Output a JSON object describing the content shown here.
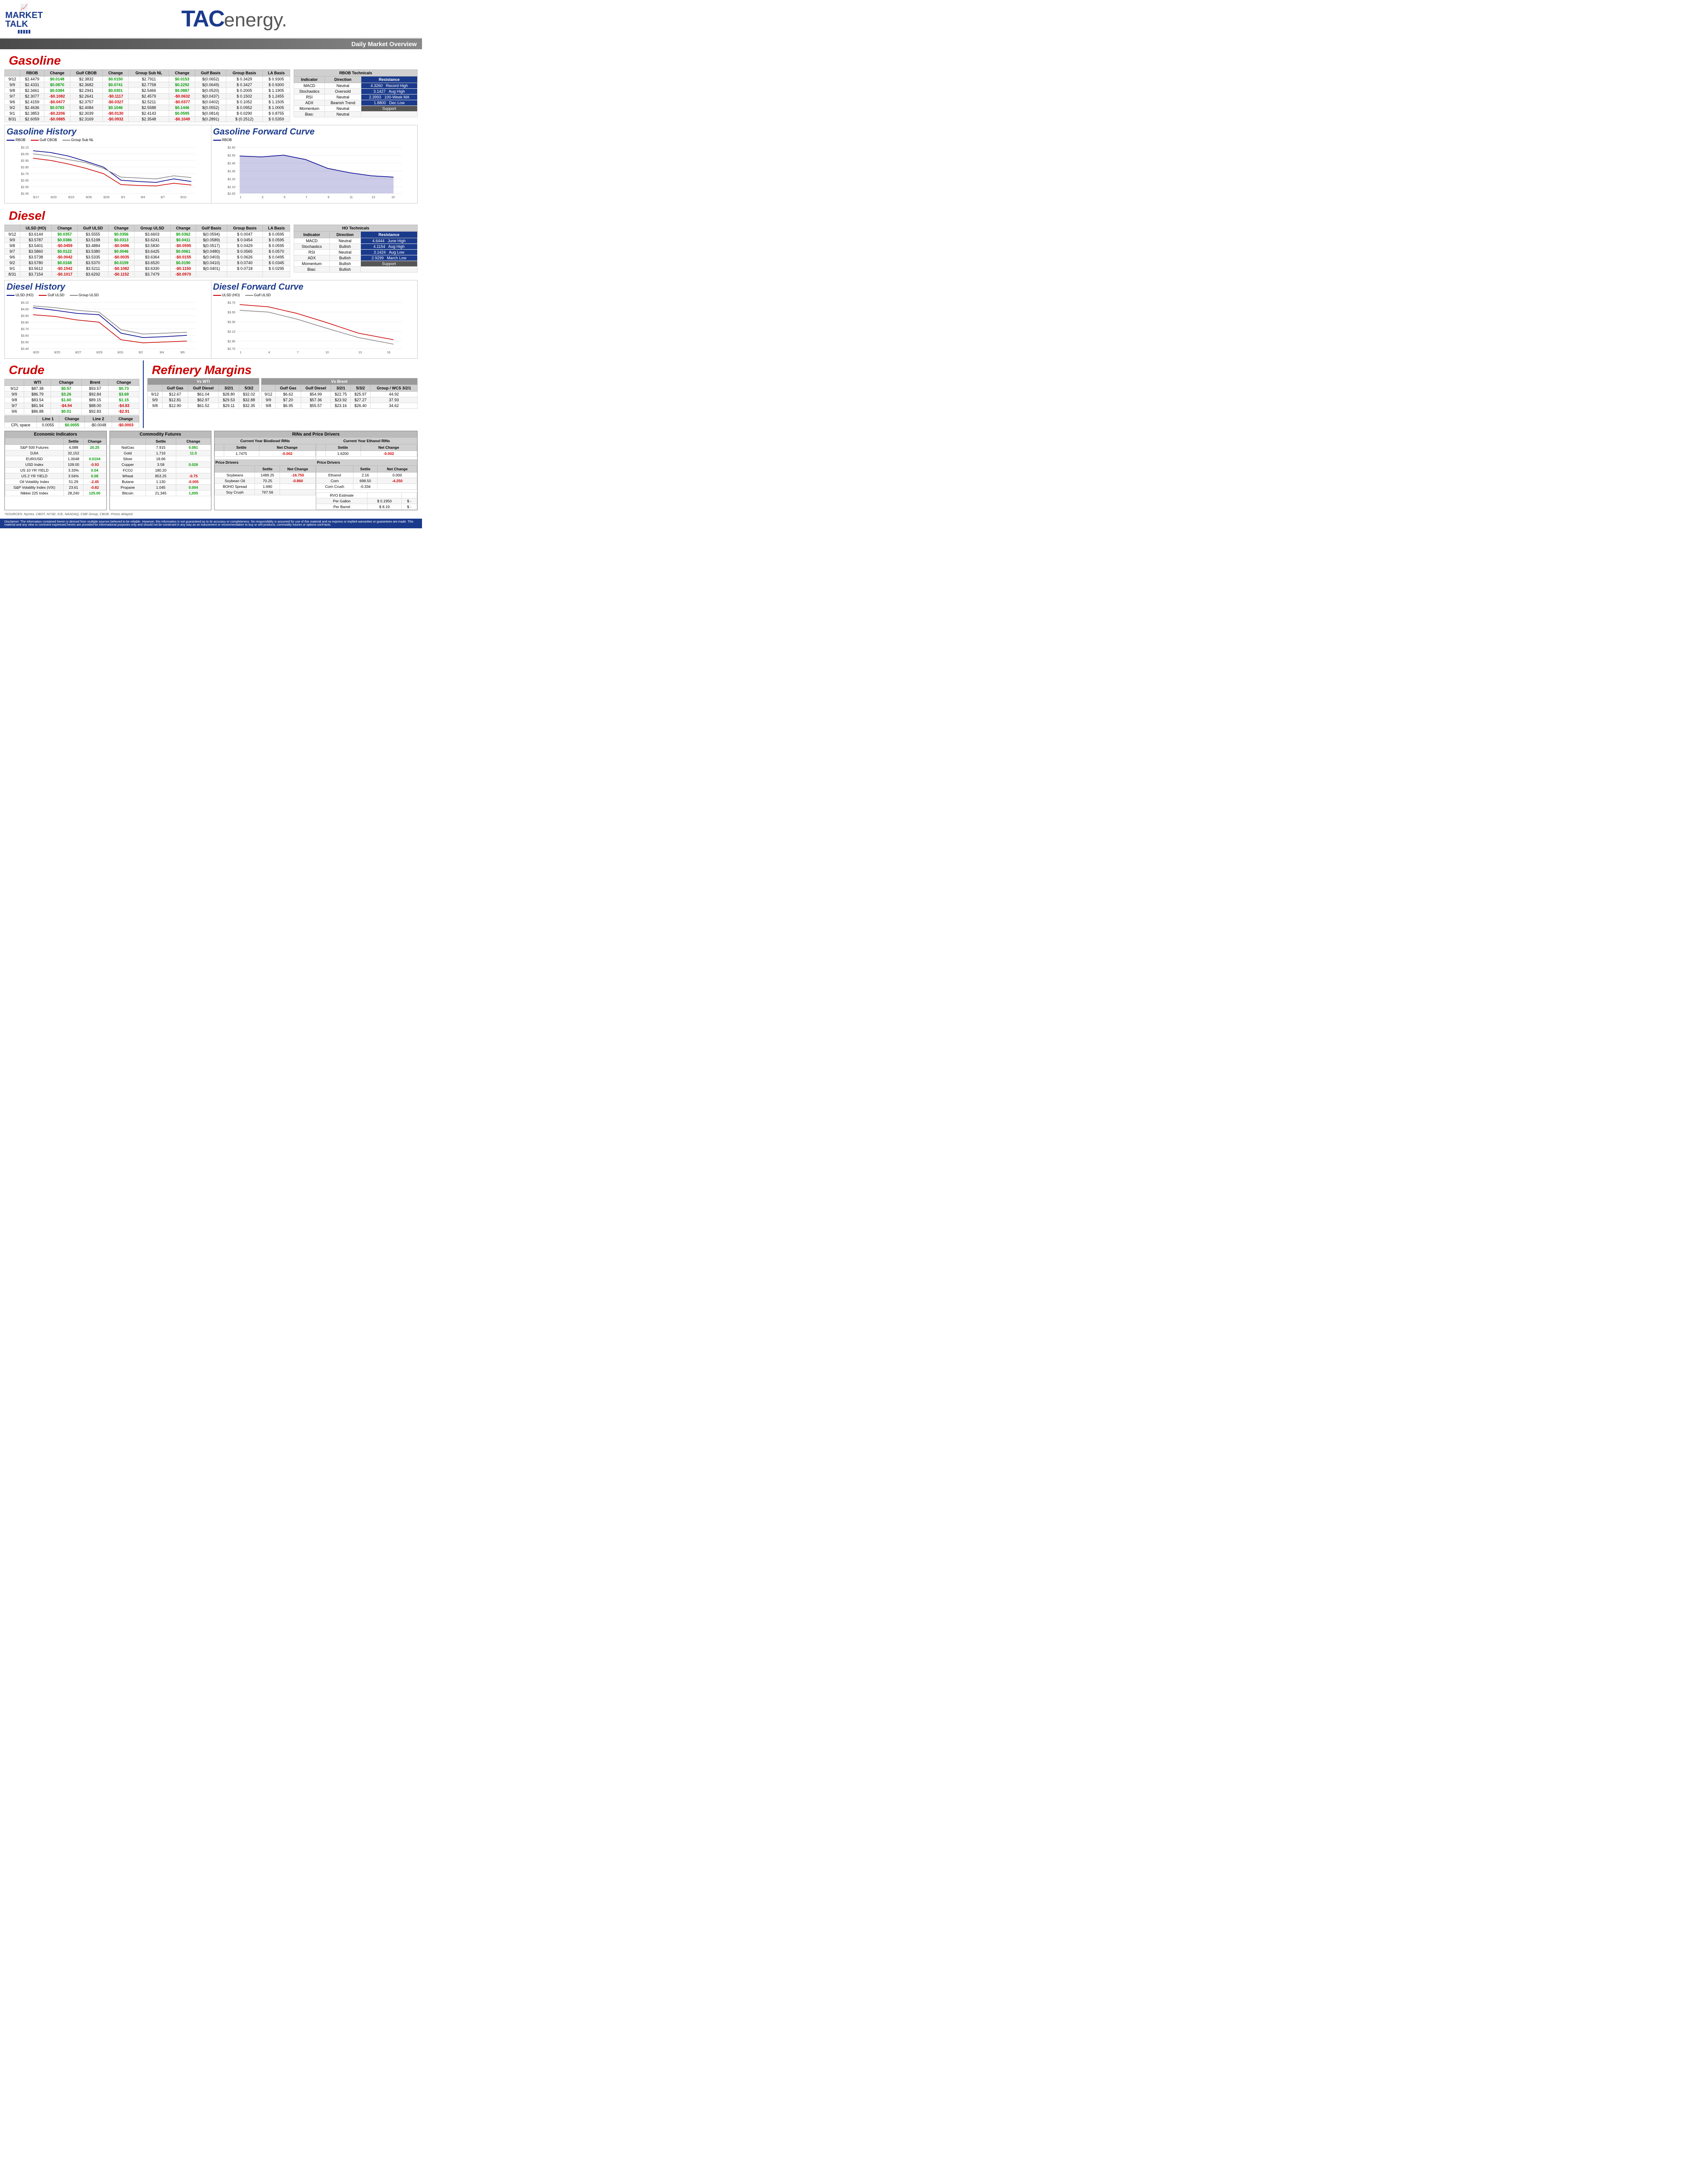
{
  "header": {
    "logo_line1": "MARKET",
    "logo_line2": "TALK",
    "tac_text": "TAC",
    "energy_text": "energy.",
    "daily_overview": "Daily Market Overview"
  },
  "gasoline": {
    "section_title": "Gasoline",
    "columns": [
      "",
      "RBOB",
      "Change",
      "Gulf CBOB",
      "Change",
      "Group Sub NL",
      "Change",
      "Gulf Basis",
      "Group Basis",
      "LA Basis"
    ],
    "rows": [
      {
        "date": "9/12",
        "rbob": "$2.4479",
        "rbob_chg": "$0.0148",
        "gulf_cbob": "$2.3832",
        "gulf_cbob_chg": "$0.0150",
        "group_sub_nl": "$2.7911",
        "group_sub_nl_chg": "$0.0153",
        "gulf_basis": "$(0.0652)",
        "group_basis": "$  0.3429",
        "la_basis": "$  0.9305"
      },
      {
        "date": "9/9",
        "rbob": "$2.4331",
        "rbob_chg": "$0.0870",
        "gulf_cbob": "$2.3682",
        "gulf_cbob_chg": "$0.0741",
        "group_sub_nl": "$2.7758",
        "group_sub_nl_chg": "$0.2292",
        "gulf_basis": "$(0.0649)",
        "group_basis": "$  0.3427",
        "la_basis": "$  0.9300"
      },
      {
        "date": "9/8",
        "rbob": "$2.3461",
        "rbob_chg": "$0.0384",
        "gulf_cbob": "$2.2941",
        "gulf_cbob_chg": "$0.0301",
        "group_sub_nl": "$2.5466",
        "group_sub_nl_chg": "$0.0887",
        "gulf_basis": "$(0.0520)",
        "group_basis": "$  0.2005",
        "la_basis": "$  1.1905"
      },
      {
        "date": "9/7",
        "rbob": "$2.3077",
        "rbob_chg": "-$0.1082",
        "gulf_cbob": "$2.2641",
        "gulf_cbob_chg": "-$0.1117",
        "group_sub_nl": "$2.4579",
        "group_sub_nl_chg": "-$0.0632",
        "gulf_basis": "$(0.0437)",
        "group_basis": "$  0.1502",
        "la_basis": "$  1.2455"
      },
      {
        "date": "9/6",
        "rbob": "$2.4159",
        "rbob_chg": "-$0.0477",
        "gulf_cbob": "$2.3757",
        "gulf_cbob_chg": "-$0.0327",
        "group_sub_nl": "$2.5211",
        "group_sub_nl_chg": "-$0.0377",
        "gulf_basis": "$(0.0402)",
        "group_basis": "$  0.1052",
        "la_basis": "$  1.1505"
      },
      {
        "date": "9/2",
        "rbob": "$2.4636",
        "rbob_chg": "$0.0783",
        "gulf_cbob": "$2.4084",
        "gulf_cbob_chg": "$0.1046",
        "group_sub_nl": "$2.5588",
        "group_sub_nl_chg": "$0.1446",
        "gulf_basis": "$(0.0552)",
        "group_basis": "$  0.0952",
        "la_basis": "$  1.0005"
      },
      {
        "date": "9/1",
        "rbob": "$2.3853",
        "rbob_chg": "-$0.2206",
        "gulf_cbob": "$2.3039",
        "gulf_cbob_chg": "-$0.0130",
        "group_sub_nl": "$2.4143",
        "group_sub_nl_chg": "$0.0595",
        "gulf_basis": "$(0.0814)",
        "group_basis": "$  0.0290",
        "la_basis": "$  0.8755"
      },
      {
        "date": "8/31",
        "rbob": "$2.6059",
        "rbob_chg": "-$0.0885",
        "gulf_cbob": "$2.3169",
        "gulf_cbob_chg": "-$0.0932",
        "group_sub_nl": "$2.3548",
        "group_sub_nl_chg": "-$0.1049",
        "gulf_basis": "$(0.2891)",
        "group_basis": "$  (0.2512)",
        "la_basis": "$  0.5359"
      }
    ],
    "technicals": {
      "title": "RBOB Technicals",
      "headers": [
        "Indicator",
        "Direction",
        "Resistance"
      ],
      "rows": [
        {
          "indicator": "MACD",
          "direction": "Neutral",
          "value": "4.3260",
          "label": "Record High"
        },
        {
          "indicator": "Stochastics",
          "direction": "Oversold",
          "value": "3.1427",
          "label": "Aug High"
        },
        {
          "indicator": "RSI",
          "direction": "Neutral",
          "value": "2.3993",
          "label": "100-Week MA"
        },
        {
          "indicator": "ADX",
          "direction": "Bearish Trend",
          "value": "1.8800",
          "label": "Dec Low"
        },
        {
          "indicator": "Momentum",
          "direction": "Neutral",
          "support_label": "Support"
        },
        {
          "indicator": "Bias:",
          "direction": "Neutral"
        }
      ]
    }
  },
  "gasoline_history": {
    "title": "Gasoline History",
    "legend": [
      "RBOB",
      "Gulf CBOB",
      "Group Sub NL"
    ],
    "y_axis": [
      "$3.15",
      "$3.05",
      "$2.95",
      "$2.85",
      "$2.75",
      "$2.65",
      "$2.55",
      "$2.45",
      "$2.35",
      "$2.25"
    ],
    "x_axis": [
      "8/17",
      "8/20",
      "8/23",
      "8/26",
      "8/29",
      "9/1",
      "9/4",
      "9/7",
      "9/10"
    ]
  },
  "gasoline_forward": {
    "title": "Gasoline Forward Curve",
    "legend": [
      "RBOB"
    ],
    "y_axis": [
      "$2.60",
      "$2.50",
      "$2.40",
      "$2.30",
      "$2.20",
      "$2.10",
      "$2.00"
    ],
    "x_axis": [
      "1",
      "3",
      "5",
      "7",
      "9",
      "11",
      "13",
      "15"
    ]
  },
  "diesel": {
    "section_title": "Diesel",
    "columns": [
      "",
      "ULSD (HO)",
      "Change",
      "Gulf ULSD",
      "Change",
      "Group ULSD",
      "Change",
      "Gulf Basis",
      "Group Basis",
      "LA Basis"
    ],
    "rows": [
      {
        "date": "9/12",
        "ulsd": "$3.6144",
        "ulsd_chg": "$0.0357",
        "gulf_ulsd": "$3.5555",
        "gulf_ulsd_chg": "$0.0356",
        "group_ulsd": "$3.6603",
        "group_ulsd_chg": "$0.0362",
        "gulf_basis": "$(0.0594)",
        "group_basis": "$  0.0047",
        "la_basis": "$  0.0595"
      },
      {
        "date": "9/9",
        "ulsd": "$3.5787",
        "ulsd_chg": "$0.0386",
        "gulf_ulsd": "$3.5198",
        "gulf_ulsd_chg": "$0.0313",
        "group_ulsd": "$3.6241",
        "group_ulsd_chg": "$0.0411",
        "gulf_basis": "$(0.0589)",
        "group_basis": "$  0.0454",
        "la_basis": "$  0.0595"
      },
      {
        "date": "9/8",
        "ulsd": "$3.5401",
        "ulsd_chg": "-$0.0459",
        "gulf_ulsd": "$3.4884",
        "gulf_ulsd_chg": "-$0.0496",
        "group_ulsd": "$3.5830",
        "group_ulsd_chg": "-$0.0595",
        "gulf_basis": "$(0.0517)",
        "group_basis": "$  0.0429",
        "la_basis": "$  0.0595"
      },
      {
        "date": "9/7",
        "ulsd": "$3.5860",
        "ulsd_chg": "$0.0122",
        "gulf_ulsd": "$3.5380",
        "gulf_ulsd_chg": "$0.0046",
        "group_ulsd": "$3.6425",
        "group_ulsd_chg": "$0.0061",
        "gulf_basis": "$(0.0480)",
        "group_basis": "$  0.0565",
        "la_basis": "$  0.0570"
      },
      {
        "date": "9/6",
        "ulsd": "$3.5738",
        "ulsd_chg": "-$0.0042",
        "gulf_ulsd": "$3.5335",
        "gulf_ulsd_chg": "-$0.0035",
        "group_ulsd": "$3.6364",
        "group_ulsd_chg": "-$0.0155",
        "gulf_basis": "$(0.0403)",
        "group_basis": "$  0.0626",
        "la_basis": "$  0.0495"
      },
      {
        "date": "9/2",
        "ulsd": "$3.5780",
        "ulsd_chg": "$0.0168",
        "gulf_ulsd": "$3.5370",
        "gulf_ulsd_chg": "$0.0159",
        "group_ulsd": "$3.6520",
        "group_ulsd_chg": "$0.0190",
        "gulf_basis": "$(0.0410)",
        "group_basis": "$  0.0740",
        "la_basis": "$  0.0345"
      },
      {
        "date": "9/1",
        "ulsd": "$3.5612",
        "ulsd_chg": "-$0.1542",
        "gulf_ulsd": "$3.5211",
        "gulf_ulsd_chg": "-$0.1082",
        "group_ulsd": "$3.6330",
        "group_ulsd_chg": "-$0.1150",
        "gulf_basis": "$(0.0401)",
        "group_basis": "$  0.0718",
        "la_basis": "$  0.0295"
      },
      {
        "date": "8/31",
        "ulsd": "$3.7154",
        "ulsd_chg": "-$0.1017",
        "gulf_ulsd": "$3.6292",
        "gulf_ulsd_chg": "-$0.1152",
        "group_ulsd": "$3.7479",
        "group_ulsd_chg": "-$0.0970",
        "gulf_basis": "",
        "group_basis": "",
        "la_basis": ""
      }
    ],
    "technicals": {
      "title": "HO Technicals",
      "headers": [
        "Indicator",
        "Direction",
        "Resistance"
      ],
      "rows": [
        {
          "indicator": "MACD",
          "direction": "Neutral",
          "value": "4.6444",
          "label": "June High"
        },
        {
          "indicator": "Stochastics",
          "direction": "Bullish",
          "value": "4.1154",
          "label": "Aug High"
        },
        {
          "indicator": "RSI",
          "direction": "Neutral",
          "value": "3.1424",
          "label": "Aug Low"
        },
        {
          "indicator": "ADX",
          "direction": "Bullish",
          "value": "2.9299",
          "label": "March Low"
        },
        {
          "indicator": "Momentum",
          "direction": "Bullish",
          "support_label": "Support"
        },
        {
          "indicator": "Bias:",
          "direction": "Bullish"
        }
      ]
    }
  },
  "diesel_history": {
    "title": "Diesel History",
    "legend": [
      "ULSD (HO)",
      "Gulf ULSD",
      "Group ULSD"
    ],
    "y_axis": [
      "$4.10",
      "$4.00",
      "$3.90",
      "$3.80",
      "$3.70",
      "$3.60",
      "$3.50",
      "$3.40",
      "$3.30"
    ],
    "x_axis": [
      "8/20",
      "8/25",
      "8/27",
      "8/29",
      "8/31",
      "9/2",
      "9/4",
      "9/6",
      "9/8"
    ]
  },
  "diesel_forward": {
    "title": "Diesel Forward Curve",
    "legend": [
      "ULSD (HO)",
      "Gulf ULSD"
    ],
    "y_axis": [
      "$3.70",
      "$3.50",
      "$3.30",
      "$3.10",
      "$2.90",
      "$2.70"
    ],
    "x_axis": [
      "1",
      "4",
      "7",
      "10",
      "13",
      "16"
    ]
  },
  "crude": {
    "section_title": "Crude",
    "columns": [
      "",
      "WTI",
      "Change",
      "Brent",
      "Change"
    ],
    "rows": [
      {
        "date": "9/12",
        "wti": "$87.38",
        "wti_chg": "$0.57",
        "brent": "$93.57",
        "brent_chg": "$0.73"
      },
      {
        "date": "9/9",
        "wti": "$86.79",
        "wti_chg": "$3.26",
        "brent": "$92.84",
        "brent_chg": "$3.69"
      },
      {
        "date": "9/8",
        "wti": "$83.54",
        "wti_chg": "$1.60",
        "brent": "$89.15",
        "brent_chg": "$1.15"
      },
      {
        "date": "9/7",
        "wti": "$81.94",
        "wti_chg": "-$4.94",
        "brent": "$88.00",
        "brent_chg": "-$4.83"
      },
      {
        "date": "9/6",
        "wti": "$86.88",
        "wti_chg": "$0.01",
        "brent": "$92.83",
        "brent_chg": "-$2.91"
      }
    ],
    "cpl_row": {
      "label": "CPL space",
      "line1": "0.0055",
      "chg": "$0.0055",
      "line2": "-$0.0048",
      "chg2": "-$0.0003"
    }
  },
  "refinery": {
    "section_title": "Refinery Margins",
    "vs_wti": {
      "header": "Vs WTI",
      "columns": [
        "Gulf Gas",
        "Gulf Diesel",
        "3/2/1",
        "5/3/2"
      ],
      "rows": [
        {
          "date": "9/12",
          "gulf_gas": "$12.67",
          "gulf_diesel": "$61.04",
          "r321": "$28.80",
          "r532": "$32.02"
        },
        {
          "date": "9/9",
          "gulf_gas": "$12.81",
          "gulf_diesel": "$62.97",
          "r321": "$29.53",
          "r532": "$32.88"
        },
        {
          "date": "9/8",
          "gulf_gas": "$12.90",
          "gulf_diesel": "$61.52",
          "r321": "$29.11",
          "r532": "$32.35"
        }
      ]
    },
    "vs_brent": {
      "header": "Vs Brent",
      "columns": [
        "Gulf Gas",
        "Gulf Diesel",
        "3/2/1",
        "5/3/2",
        "Group / WCS 3/2/1"
      ],
      "rows": [
        {
          "date": "9/12",
          "gulf_gas": "$6.62",
          "gulf_diesel": "$54.99",
          "r321": "$22.75",
          "r532": "$25.97",
          "wcs": "44.92"
        },
        {
          "date": "9/9",
          "gulf_gas": "$7.20",
          "gulf_diesel": "$57.36",
          "r321": "$23.92",
          "r532": "$27.27",
          "wcs": "37.93"
        },
        {
          "date": "9/8",
          "gulf_gas": "$6.95",
          "gulf_diesel": "$55.57",
          "r321": "$23.16",
          "r532": "$26.40",
          "wcs": "34.62"
        }
      ]
    }
  },
  "economic_indicators": {
    "title": "Economic Indicators",
    "columns": [
      "",
      "Settle",
      "Change"
    ],
    "rows": [
      {
        "label": "S&P 500 Futures",
        "settle": "4,088",
        "change": "20.25",
        "pos": true
      },
      {
        "label": "DJIA",
        "settle": "32,152",
        "change": "",
        "pos": false
      },
      {
        "label": "EUR/USD",
        "settle": "1.0048",
        "change": "0.0104",
        "pos": true
      },
      {
        "label": "USD Index",
        "settle": "109.00",
        "change": "-0.93",
        "pos": false
      },
      {
        "label": "US 10 YR YIELD",
        "settle": "3.33%",
        "change": "0.04",
        "pos": true
      },
      {
        "label": "US 2 YR YIELD",
        "settle": "3.56%",
        "change": "0.08",
        "pos": true
      },
      {
        "label": "Oil Volatility Index",
        "settle": "51.29",
        "change": "-2.45",
        "pos": false
      },
      {
        "label": "S&P Volatility Index (VIX)",
        "settle": "23.61",
        "change": "-0.82",
        "pos": false
      },
      {
        "label": "Nikkei 225 Index",
        "settle": "28,240",
        "change": "125.00",
        "pos": true
      }
    ]
  },
  "commodity_futures": {
    "title": "Commodity Futures",
    "columns": [
      "",
      "Settle",
      "Change"
    ],
    "rows": [
      {
        "label": "NatGas",
        "settle": "7.915",
        "change": "0.081",
        "pos": true
      },
      {
        "label": "Gold",
        "settle": "1,716",
        "change": "11.5",
        "pos": true
      },
      {
        "label": "Silver",
        "settle": "18.66",
        "change": "",
        "pos": false
      },
      {
        "label": "Copper",
        "settle": "3.58",
        "change": "0.026",
        "pos": true
      },
      {
        "label": "FCOJ",
        "settle": "180.20",
        "change": "",
        "pos": false
      },
      {
        "label": "Wheat",
        "settle": "853.25",
        "change": "-0.75",
        "pos": false
      },
      {
        "label": "Butane",
        "settle": "1.130",
        "change": "-0.005",
        "pos": false
      },
      {
        "label": "Propane",
        "settle": "1.045",
        "change": "0.004",
        "pos": true
      },
      {
        "label": "Bitcoin",
        "settle": "21,345",
        "change": "1,005",
        "pos": true
      }
    ]
  },
  "rins": {
    "section_title": "RINs and Price Drivers",
    "biodiesel": {
      "title": "Current Year Biodiesel RINs",
      "columns": [
        "",
        "Settle",
        "Net Change"
      ],
      "settle": "1.7475",
      "net_change": "-0.002",
      "net_change_neg": true
    },
    "ethanol": {
      "title": "Current Year Ethanol RINs",
      "columns": [
        "",
        "Settle",
        "Net Change"
      ],
      "settle": "1.6200",
      "net_change": "-0.002",
      "net_change_neg": true
    },
    "price_drivers_left": {
      "title": "Price Drivers",
      "headers": [
        "",
        "Settle",
        "Net Change"
      ],
      "rows": [
        {
          "label": "Soybeans",
          "settle": "1489.25",
          "change": "-16.750",
          "neg": true
        },
        {
          "label": "Soybean Oil",
          "settle": "70.25",
          "change": "-0.860",
          "neg": true
        },
        {
          "label": "BOHO Spread",
          "settle": "1.690",
          "change": "",
          "neg": false
        },
        {
          "label": "Soy Crush",
          "settle": "767.56",
          "change": "",
          "neg": false
        }
      ]
    },
    "price_drivers_right": {
      "title": "Price Drivers",
      "headers": [
        "",
        "Settle",
        "Net Change"
      ],
      "rows": [
        {
          "label": "Ethanol",
          "settle": "2.16",
          "change": "0.000",
          "neg": false
        },
        {
          "label": "Corn",
          "settle": "698.50",
          "change": "-4.250",
          "neg": true
        },
        {
          "label": "Corn Crush",
          "settle": "-0.334",
          "change": "",
          "neg": false
        }
      ]
    },
    "rvo": {
      "title": "RVO Estimate",
      "per_gallon_label": "Per Gallon",
      "per_gallon_value": "$ 0.1950",
      "per_gallon_dash": "$    -",
      "per_barrel_label": "Per Barrel",
      "per_barrel_value": "$  8.19",
      "per_barrel_dash": "$    -"
    }
  },
  "footer": {
    "sources": "*SOURCES: Nymex, CBOT, NYSE, ICE, NASDAQ, CME Group, CBOE.  Prices delayed.",
    "disclaimer": "Disclaimer: The information contained herein is derived from multiple sources believed to be reliable. However, this information is not guaranteed as to its accuracy or completeness. No responsibility is assumed for use of this material and no express or implied warranties or guarantees are made. This material and any view or comment expressed herein are provided for informational purposes only and should not be construed in any way as an inducement or recommendation to buy or sell products, commodity futures or options cont'racts."
  }
}
